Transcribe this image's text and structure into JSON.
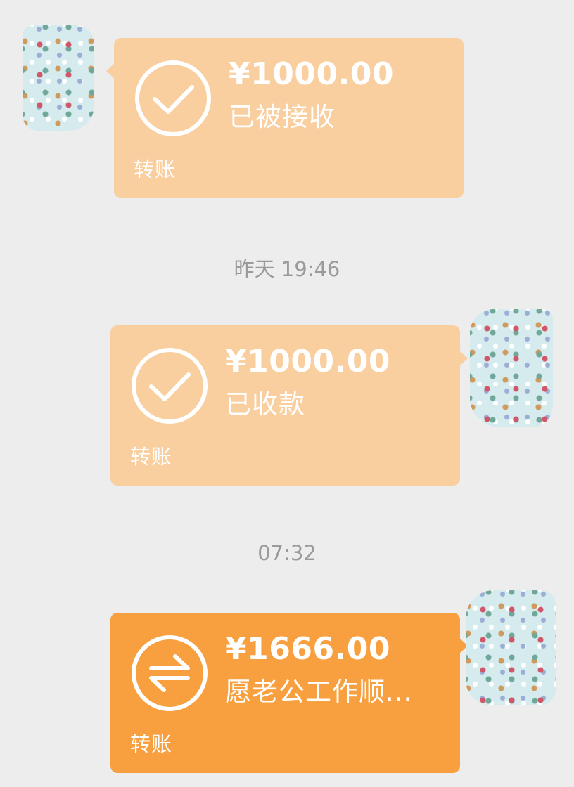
{
  "colors": {
    "background": "#ededed",
    "transfer_done": "#f9cfa0",
    "transfer_pending": "#f8a03f",
    "text_on_bubble": "#ffffff",
    "timestamp_text": "#9a9a9a"
  },
  "messages": [
    {
      "direction": "received",
      "amount": "¥1000.00",
      "status": "已被接收",
      "type_label": "转账",
      "icon": "checkmark-circle-icon"
    },
    {
      "timestamp": "昨天 19:46"
    },
    {
      "direction": "sent",
      "amount": "¥1000.00",
      "status": "已收款",
      "type_label": "转账",
      "icon": "checkmark-circle-icon"
    },
    {
      "timestamp": "07:32"
    },
    {
      "direction": "sent",
      "amount": "¥1666.00",
      "status": "愿老公工作顺...",
      "type_label": "转账",
      "icon": "transfer-arrows-icon"
    }
  ]
}
